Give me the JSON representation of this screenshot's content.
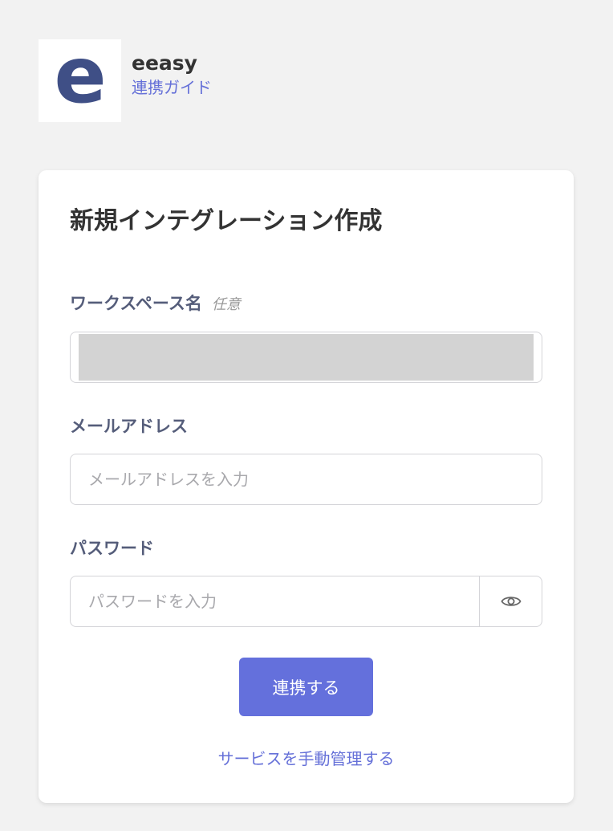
{
  "header": {
    "logo_letter": "e",
    "app_name": "eeasy",
    "guide_link": "連携ガイド"
  },
  "form": {
    "title": "新規インテグレーション作成",
    "workspace": {
      "label": "ワークスペース名",
      "optional": "任意",
      "value": ""
    },
    "email": {
      "label": "メールアドレス",
      "placeholder": "メールアドレスを入力",
      "value": ""
    },
    "password": {
      "label": "パスワード",
      "placeholder": "パスワードを入力",
      "value": ""
    },
    "submit_label": "連携する",
    "manual_link": "サービスを手動管理する"
  },
  "colors": {
    "accent": "#6470dc",
    "link": "#6570d8",
    "logo": "#3f4f86",
    "background": "#f2f2f2"
  },
  "icons": {
    "password_toggle": "eye-icon"
  }
}
